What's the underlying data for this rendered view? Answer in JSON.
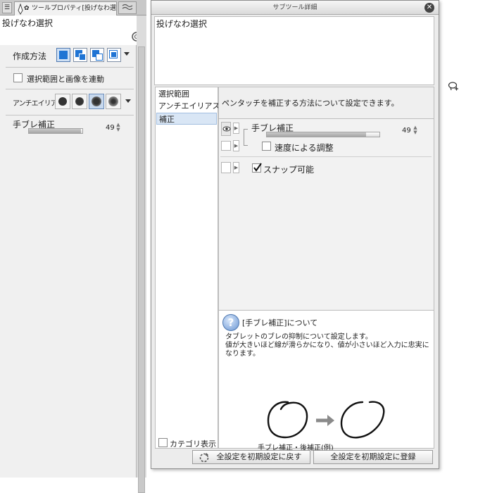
{
  "tool_property": {
    "tab_title": "ツールプロパティ[投げなわ選択]",
    "tool_name": "投げなわ選択",
    "create_method_label": "作成方法",
    "link_checkbox_label": "選択範囲と画像を連動",
    "antialias_label": "アンチエイリアス",
    "stabilization_label": "手ブレ補正",
    "stabilization_value": "49",
    "stabilization_fraction": 0.49,
    "link_checked": false,
    "antialias_selected_index": 2,
    "create_method_selected_index": 0
  },
  "sub_tool_detail": {
    "window_title": "サブツール詳細",
    "tool_name": "投げなわ選択",
    "categories": [
      {
        "label": "選択範囲",
        "selected": false
      },
      {
        "label": "アンチエイリアス",
        "selected": false
      },
      {
        "label": "補正",
        "selected": true
      }
    ],
    "category_toggle_label": "カテゴリ表示",
    "category_toggle_checked": false,
    "description": "ペンタッチを補正する方法について設定できます。",
    "stabilization": {
      "label": "手ブレ補正",
      "value": "49",
      "fraction": 0.49,
      "shown_in_tool_property": true
    },
    "speed_adjust": {
      "label": "速度による調整",
      "checked": false
    },
    "snap": {
      "label": "スナップ可能",
      "checked": true
    },
    "help": {
      "title": "[手ブレ補正]について",
      "text_line1": "タブレットのブレの抑制について設定します。",
      "text_line2": "値が大きいほど線が滑らかになり、値が小さいほど入力に忠実に",
      "text_line3": "なります。",
      "example_caption": "手ブレ補正・後補正(例)"
    },
    "reset_button_label": "全設定を初期設定に戻す",
    "register_button_label": "全設定を初期設定に登録"
  },
  "colors": {
    "accent": "#4f78b0",
    "selection_bg": "#d9e6f5"
  },
  "icons": [
    "menu-icon",
    "pen-tool-icon",
    "gear-icon",
    "tool-search-icon",
    "close-icon",
    "eye-icon",
    "expand-arrow-icon",
    "help-icon",
    "reset-icon",
    "lasso-cursor-icon"
  ]
}
